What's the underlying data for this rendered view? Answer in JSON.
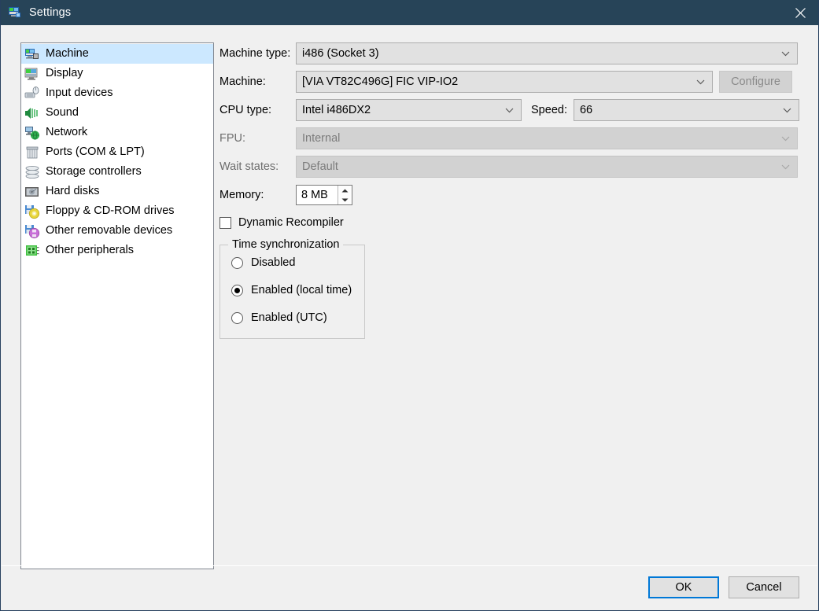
{
  "window": {
    "title": "Settings",
    "icon": "settings-app-icon",
    "close_icon": "close-icon",
    "titlebar_color": "#274458",
    "background_color": "#f0f0f0"
  },
  "sidebar": {
    "selected_index": 0,
    "highlight_color": "#cce8ff",
    "items": [
      {
        "label": "Machine",
        "icon": "machine-icon"
      },
      {
        "label": "Display",
        "icon": "display-icon"
      },
      {
        "label": "Input devices",
        "icon": "input-devices-icon"
      },
      {
        "label": "Sound",
        "icon": "sound-icon"
      },
      {
        "label": "Network",
        "icon": "network-icon"
      },
      {
        "label": "Ports (COM & LPT)",
        "icon": "ports-icon"
      },
      {
        "label": "Storage controllers",
        "icon": "storage-controllers-icon"
      },
      {
        "label": "Hard disks",
        "icon": "hard-disks-icon"
      },
      {
        "label": "Floppy & CD-ROM drives",
        "icon": "floppy-cdrom-icon"
      },
      {
        "label": "Other removable devices",
        "icon": "other-removable-icon"
      },
      {
        "label": "Other peripherals",
        "icon": "other-peripherals-icon"
      }
    ]
  },
  "form": {
    "machine_type": {
      "label": "Machine type:",
      "value": "i486 (Socket 3)",
      "enabled": true
    },
    "machine": {
      "label": "Machine:",
      "value": "[VIA VT82C496G] FIC VIP-IO2",
      "enabled": true
    },
    "configure": {
      "label": "Configure",
      "enabled": false
    },
    "cpu_type": {
      "label": "CPU type:",
      "value": "Intel i486DX2",
      "enabled": true
    },
    "speed": {
      "label": "Speed:",
      "value": "66",
      "enabled": true
    },
    "fpu": {
      "label": "FPU:",
      "value": "Internal",
      "enabled": false
    },
    "wait_states": {
      "label": "Wait states:",
      "value": "Default",
      "enabled": false
    },
    "memory": {
      "label": "Memory:",
      "value": "8 MB"
    },
    "dynamic_recompiler": {
      "label": "Dynamic Recompiler",
      "checked": false
    },
    "time_sync": {
      "title": "Time synchronization",
      "selected_index": 1,
      "options": [
        {
          "label": "Disabled"
        },
        {
          "label": "Enabled (local time)"
        },
        {
          "label": "Enabled (UTC)"
        }
      ]
    }
  },
  "footer": {
    "ok_label": "OK",
    "cancel_label": "Cancel",
    "focus_color": "#0078d7"
  }
}
